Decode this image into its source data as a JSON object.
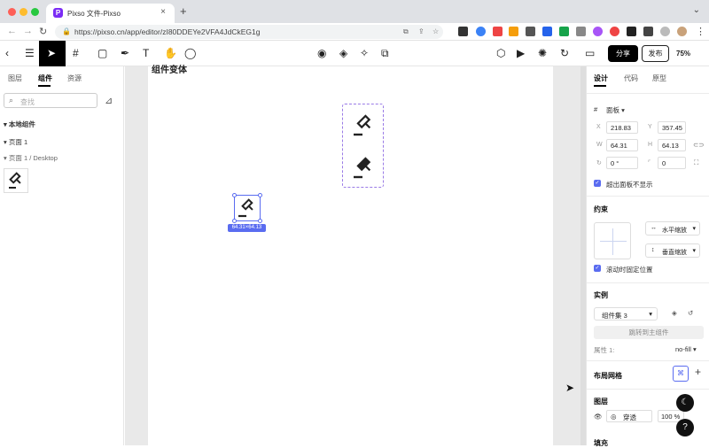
{
  "browser": {
    "tab_title": "Pixso 文件-Pixso",
    "favicon_letter": "P",
    "url": "https://pixso.cn/app/editor/zI80DDEYe2VFA4JdCkEG1g",
    "new_tab": "+",
    "close": "×"
  },
  "toolbar": {
    "share_label": "分享",
    "publish_label": "发布",
    "zoom_label": "75%"
  },
  "left_panel": {
    "tabs": [
      "图层",
      "组件",
      "资源"
    ],
    "search_placeholder": "查找",
    "section_title": "本地组件",
    "page_row": "页面 1",
    "frame_row": "页面 1 / Desktop"
  },
  "canvas": {
    "artboard_title": "组件变体",
    "dimension_tag": "64.31×64.13"
  },
  "right_panel": {
    "tabs": [
      "设计",
      "代码",
      "原型"
    ],
    "frame_type": "面板",
    "x": "218.83",
    "y": "357.45",
    "w": "64.31",
    "h": "64.13",
    "rotation": "0 °",
    "radius": "0",
    "clip_label": "超出面板不显示",
    "constraints_title": "约束",
    "h_constraint": "水平缩放",
    "v_constraint": "垂直缩放",
    "fix_scroll_label": "滚动时固定位置",
    "instance_title": "实例",
    "component_set": "组件集 3",
    "goto_main": "跳转到主组件",
    "property_label": "属性 1:",
    "property_value": "no-fill",
    "layout_grid_title": "布局网格",
    "layer_title": "图层",
    "blend_mode": "穿透",
    "opacity": "100 %",
    "fill_title": "填充"
  },
  "colors": {
    "selection": "#5a6cf0",
    "variant_border": "#9a7be6",
    "brand": "#7b2cf5"
  }
}
